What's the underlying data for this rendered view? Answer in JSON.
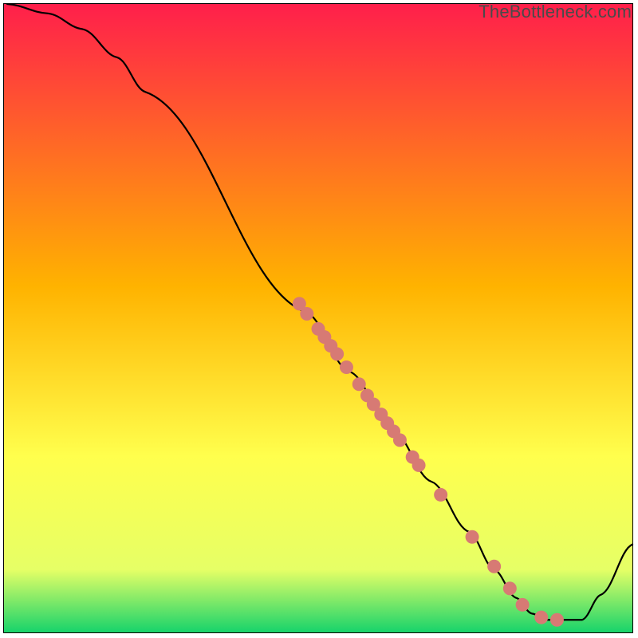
{
  "watermark": "TheBottleneck.com",
  "chart_data": {
    "type": "line",
    "title": "",
    "xlabel": "",
    "ylabel": "",
    "xlim": [
      0,
      100
    ],
    "ylim": [
      0,
      100
    ],
    "gradient": {
      "top": "#ff1f4b",
      "upper_mid": "#ffb300",
      "lower_mid": "#ffff4d",
      "near_bottom": "#e6ff66",
      "bottom": "#17d36b"
    },
    "curve": [
      {
        "x": 0.5,
        "y": 100.0
      },
      {
        "x": 7.0,
        "y": 98.5
      },
      {
        "x": 12.5,
        "y": 96.0
      },
      {
        "x": 18.0,
        "y": 91.5
      },
      {
        "x": 22.5,
        "y": 86.0
      },
      {
        "x": 48.0,
        "y": 51.0
      },
      {
        "x": 55.0,
        "y": 41.5
      },
      {
        "x": 62.0,
        "y": 32.0
      },
      {
        "x": 68.0,
        "y": 24.0
      },
      {
        "x": 74.0,
        "y": 16.0
      },
      {
        "x": 78.0,
        "y": 10.0
      },
      {
        "x": 81.5,
        "y": 5.5
      },
      {
        "x": 84.0,
        "y": 3.0
      },
      {
        "x": 86.5,
        "y": 2.0
      },
      {
        "x": 89.5,
        "y": 2.0
      },
      {
        "x": 92.0,
        "y": 2.0
      },
      {
        "x": 95.0,
        "y": 6.0
      },
      {
        "x": 100.0,
        "y": 14.0
      }
    ],
    "points": [
      {
        "x": 47.0,
        "y": 52.3
      },
      {
        "x": 48.2,
        "y": 50.7
      },
      {
        "x": 50.0,
        "y": 48.3
      },
      {
        "x": 51.0,
        "y": 47.0
      },
      {
        "x": 52.0,
        "y": 45.6
      },
      {
        "x": 53.0,
        "y": 44.3
      },
      {
        "x": 54.5,
        "y": 42.2
      },
      {
        "x": 56.5,
        "y": 39.5
      },
      {
        "x": 57.8,
        "y": 37.7
      },
      {
        "x": 58.8,
        "y": 36.3
      },
      {
        "x": 60.0,
        "y": 34.7
      },
      {
        "x": 61.0,
        "y": 33.3
      },
      {
        "x": 62.0,
        "y": 32.0
      },
      {
        "x": 63.0,
        "y": 30.6
      },
      {
        "x": 65.0,
        "y": 27.9
      },
      {
        "x": 66.0,
        "y": 26.6
      },
      {
        "x": 69.5,
        "y": 21.9
      },
      {
        "x": 74.5,
        "y": 15.2
      },
      {
        "x": 78.0,
        "y": 10.5
      },
      {
        "x": 80.5,
        "y": 7.0
      },
      {
        "x": 82.5,
        "y": 4.4
      },
      {
        "x": 85.5,
        "y": 2.4
      },
      {
        "x": 88.0,
        "y": 2.0
      }
    ],
    "point_color": "#d77a74",
    "curve_color": "#000000"
  }
}
